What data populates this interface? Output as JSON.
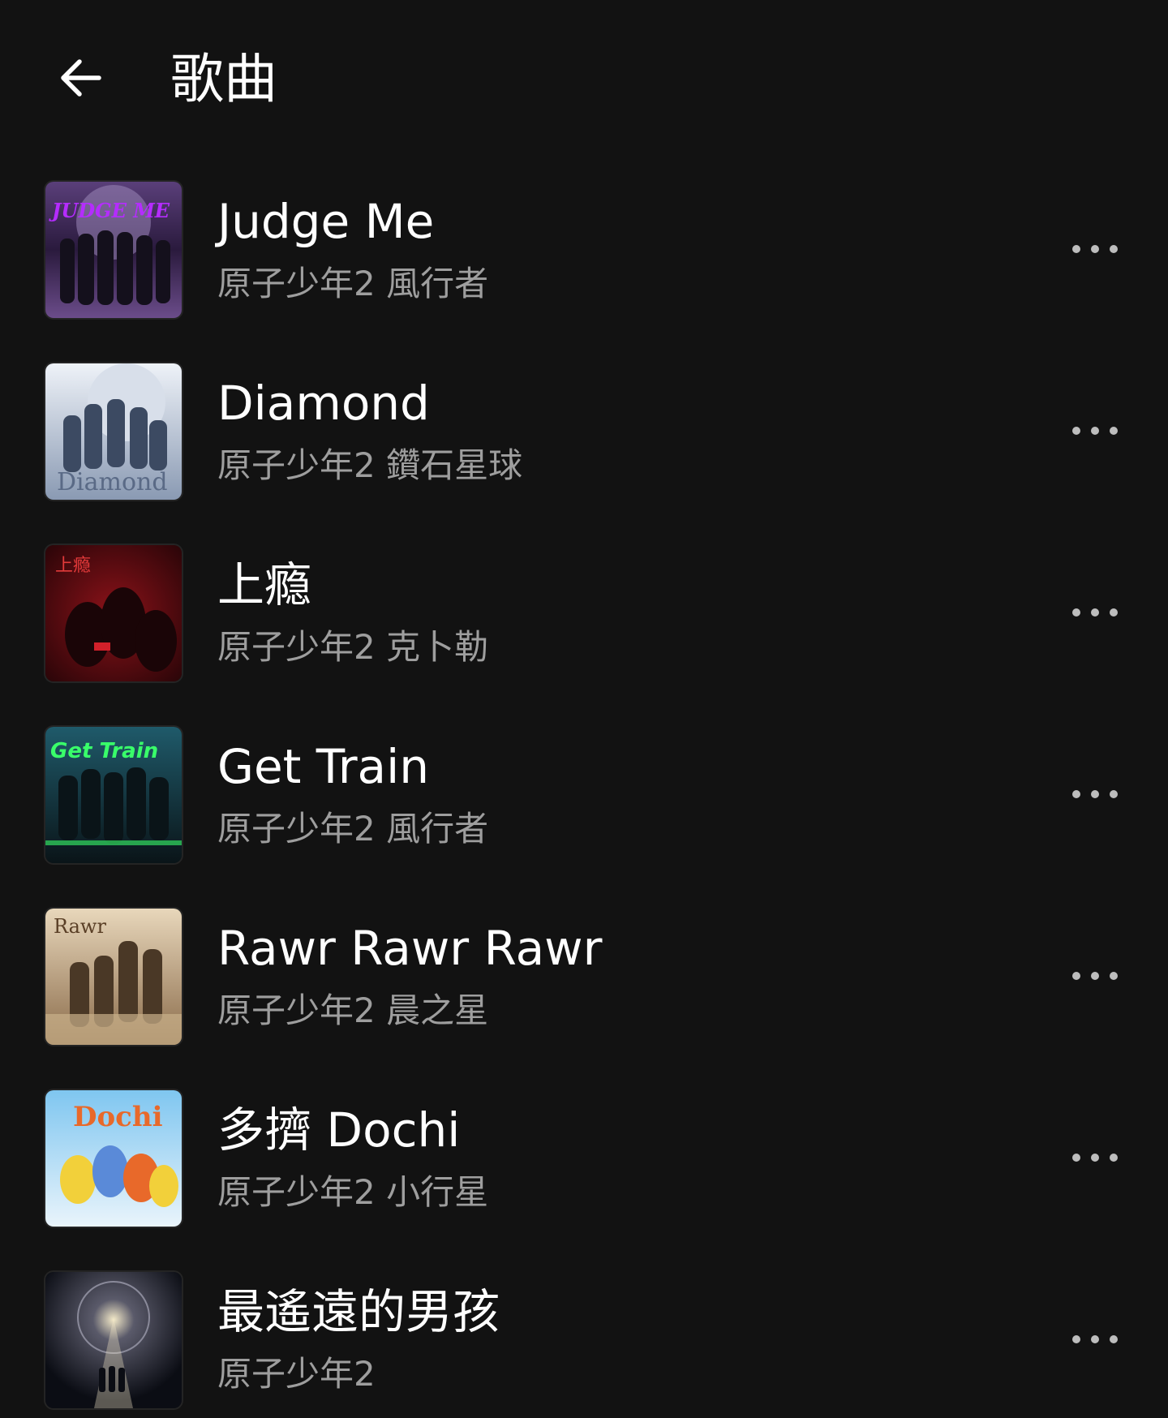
{
  "header": {
    "back_icon": "arrow-left-icon",
    "title": "歌曲"
  },
  "colors": {
    "background": "#121212",
    "primary_text": "#ffffff",
    "secondary_text": "#9e9e9e"
  },
  "songs": [
    {
      "title": "Judge Me",
      "artist": "原子少年2 風行者",
      "cover_text": "JUDGE ME",
      "cover_palette": [
        "#2a1a3d",
        "#6b4c8a",
        "#b88fd6",
        "#a020f0"
      ]
    },
    {
      "title": "Diamond",
      "artist": "原子少年2 鑽石星球",
      "cover_text": "Diamond",
      "cover_palette": [
        "#c8d2e0",
        "#7f8ea6",
        "#3c4a62",
        "#eef2f8"
      ]
    },
    {
      "title": "上瘾",
      "artist": "原子少年2 克卜勒",
      "cover_text": "上瘾",
      "cover_palette": [
        "#3a0a0e",
        "#8c1219",
        "#d2202a",
        "#1a0507"
      ]
    },
    {
      "title": "Get Train",
      "artist": "原子少年2 風行者",
      "cover_text": "Get Train",
      "cover_palette": [
        "#0f2a33",
        "#1f5a6a",
        "#39ff6a",
        "#0a1418"
      ]
    },
    {
      "title": "Rawr Rawr Rawr",
      "artist": "原子少年2 晨之星",
      "cover_text": "Rawr",
      "cover_palette": [
        "#c9b08a",
        "#8a6b4a",
        "#e8d7bb",
        "#4a3826"
      ]
    },
    {
      "title": "多擠 Dochi",
      "artist": "原子少年2 小行星",
      "cover_text": "Dochi",
      "cover_palette": [
        "#7fc6f0",
        "#f2d03a",
        "#e8692a",
        "#ffffff"
      ]
    },
    {
      "title": "最遙遠的男孩",
      "artist": "原子少年2",
      "cover_text": "",
      "cover_palette": [
        "#0b0d14",
        "#2c3448",
        "#f3e9c8",
        "#5a4a3a"
      ]
    }
  ],
  "row_more_icon": "more-horizontal-icon"
}
